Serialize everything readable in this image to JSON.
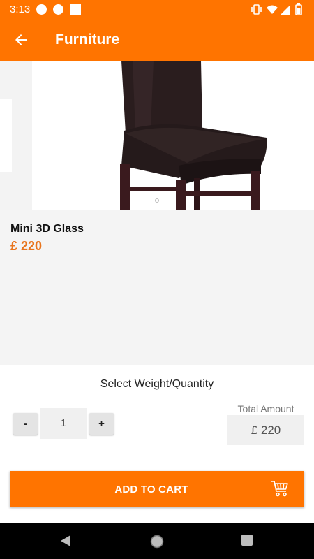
{
  "status_bar": {
    "time": "3:13",
    "icons": [
      "notification-dot-icon",
      "notification-dot-icon",
      "notification-square-icon",
      "vibrate-icon",
      "wifi-icon",
      "signal-icon",
      "battery-icon"
    ]
  },
  "app_bar": {
    "title": "Furniture",
    "back_icon": "arrow-back-icon"
  },
  "product": {
    "image": "leather-dining-chair",
    "name": "Mini 3D Glass",
    "price": "£ 220"
  },
  "selection": {
    "title": "Select Weight/Quantity",
    "minus_label": "-",
    "quantity": "1",
    "plus_label": "+",
    "total_label": "Total Amount",
    "total_value": "£ 220"
  },
  "cart_button": {
    "label": "ADD TO CART",
    "icon": "shopping-cart-icon"
  },
  "nav_bar": {
    "buttons": [
      "back-triangle-icon",
      "home-circle-icon",
      "recents-square-icon"
    ]
  },
  "colors": {
    "primary": "#ff7400",
    "price": "#e8741c",
    "background": "#f4f4f4"
  }
}
